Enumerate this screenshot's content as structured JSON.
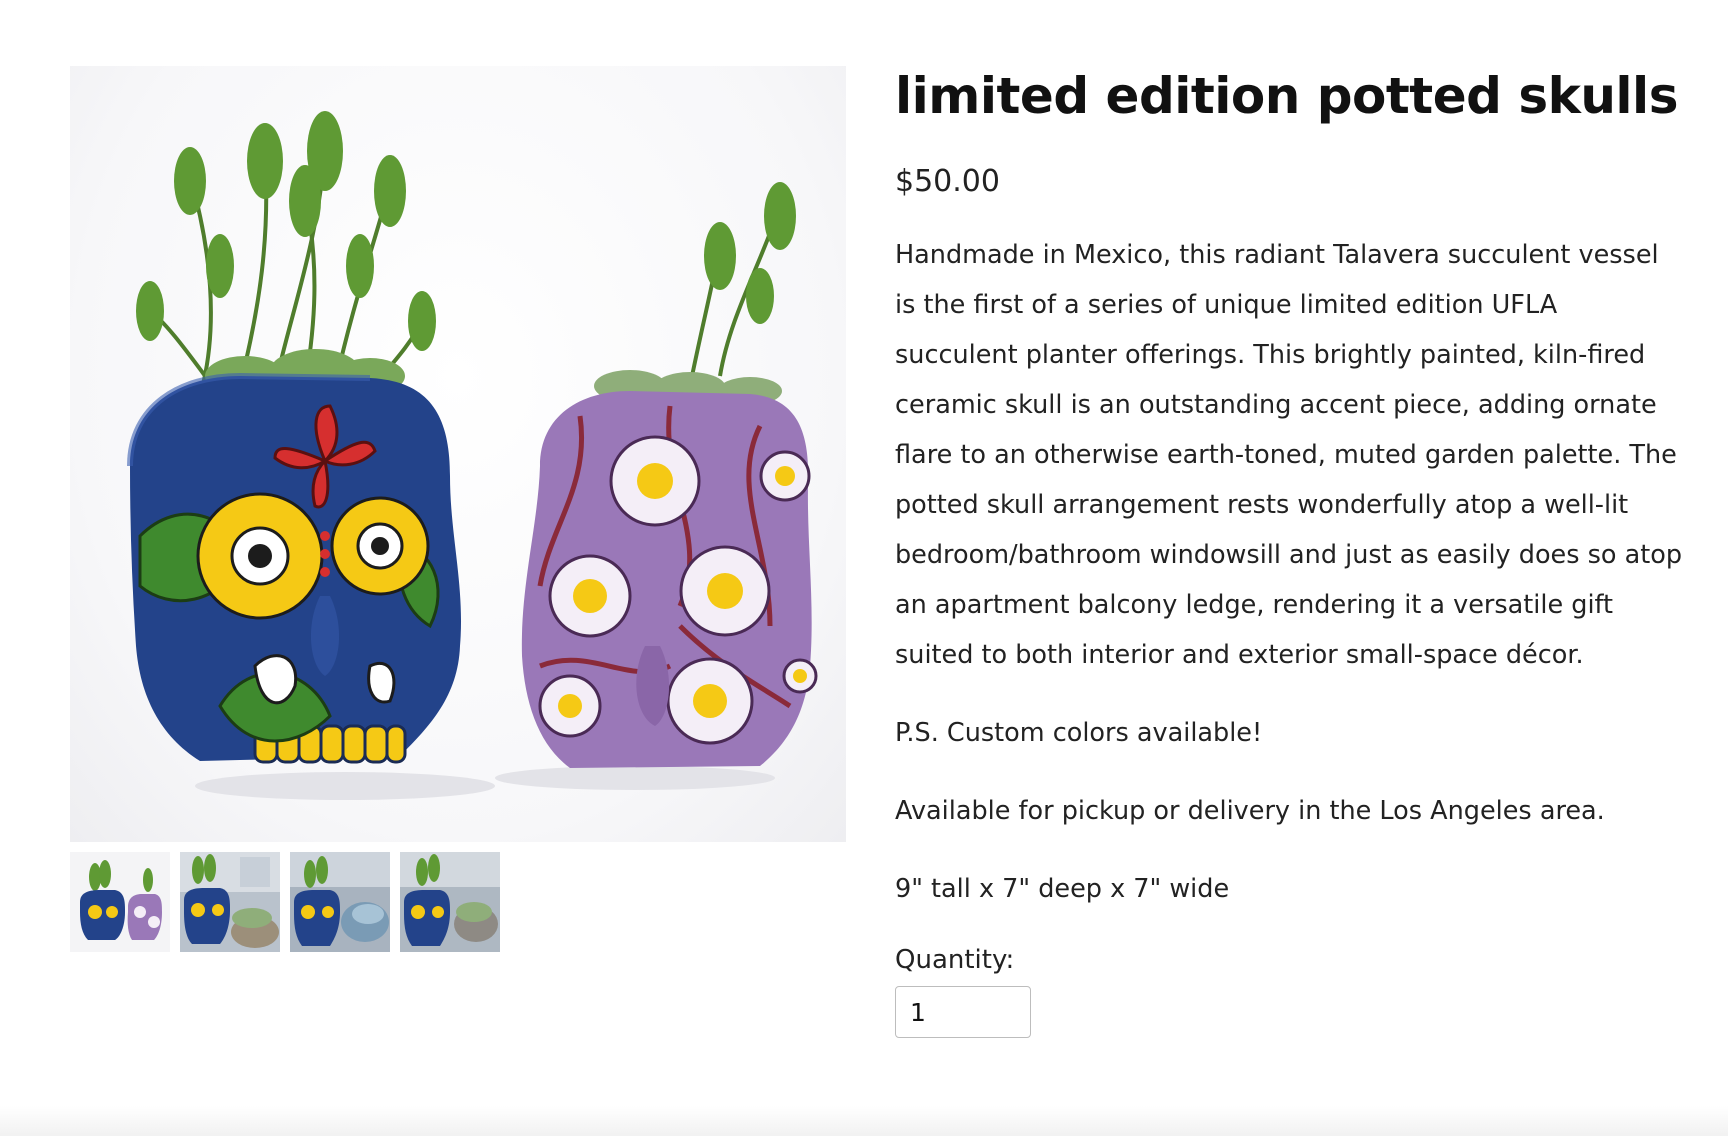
{
  "product": {
    "title": "limited edition potted skulls",
    "price": "$50.00",
    "description": "Handmade in Mexico, this radiant Talavera succulent vessel is the first of a series of unique limited edition UFLA succulent planter offerings. This brightly painted, kiln-fired ceramic skull is an outstanding accent piece, adding ornate flare to an otherwise earth-toned, muted garden palette. The potted skull arrangement rests wonderfully atop a well-lit bedroom/bathroom windowsill and just as easily does so atop an apartment balcony ledge, rendering it a versatile gift suited to both interior and exterior small-space décor.",
    "note": "P.S. Custom colors available!",
    "availability": "Available for pickup or delivery in the Los Angeles area.",
    "dimensions": "9\" tall x 7\" deep x 7\" wide",
    "quantity_label": "Quantity:",
    "quantity_value": "1"
  },
  "gallery": {
    "main_image": "photo of blue and purple talavera skull planters with succulents",
    "thumbnails": [
      {
        "name": "thumbnail-1"
      },
      {
        "name": "thumbnail-2"
      },
      {
        "name": "thumbnail-3"
      },
      {
        "name": "thumbnail-4"
      }
    ]
  },
  "colors": {
    "blue_skull": "#23438a",
    "purple_skull": "#9a78b8",
    "sunflower": "#f5c915",
    "leaf_green": "#3f8a2e"
  }
}
